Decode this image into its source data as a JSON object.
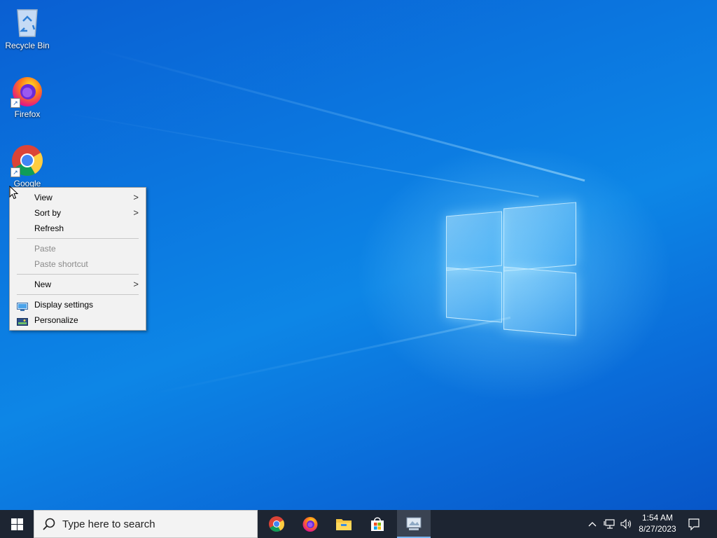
{
  "desktop": {
    "icons": [
      {
        "label": "Recycle Bin"
      },
      {
        "label": "Firefox"
      },
      {
        "label": "Google"
      }
    ]
  },
  "context_menu": {
    "items": [
      {
        "label": "View",
        "submenu": true,
        "enabled": true
      },
      {
        "label": "Sort by",
        "submenu": true,
        "enabled": true
      },
      {
        "label": "Refresh",
        "submenu": false,
        "enabled": true
      },
      {
        "label": "Paste",
        "submenu": false,
        "enabled": false
      },
      {
        "label": "Paste shortcut",
        "submenu": false,
        "enabled": false
      },
      {
        "label": "New",
        "submenu": true,
        "enabled": true
      },
      {
        "label": "Display settings",
        "icon": "display-icon",
        "enabled": true
      },
      {
        "label": "Personalize",
        "icon": "personalize-icon",
        "enabled": true
      }
    ],
    "submenu_arrow": ">"
  },
  "taskbar": {
    "search_placeholder": "Type here to search",
    "apps": [
      "chrome-icon",
      "firefox-icon",
      "file-explorer-icon",
      "store-icon",
      "app-icon"
    ],
    "tray": {
      "time": "1:54 AM",
      "date": "8/27/2023"
    }
  },
  "colors": {
    "taskbar": "#1d2532",
    "menu_bg": "#f2f2f2",
    "desktop_accent": "#0b78e0"
  }
}
